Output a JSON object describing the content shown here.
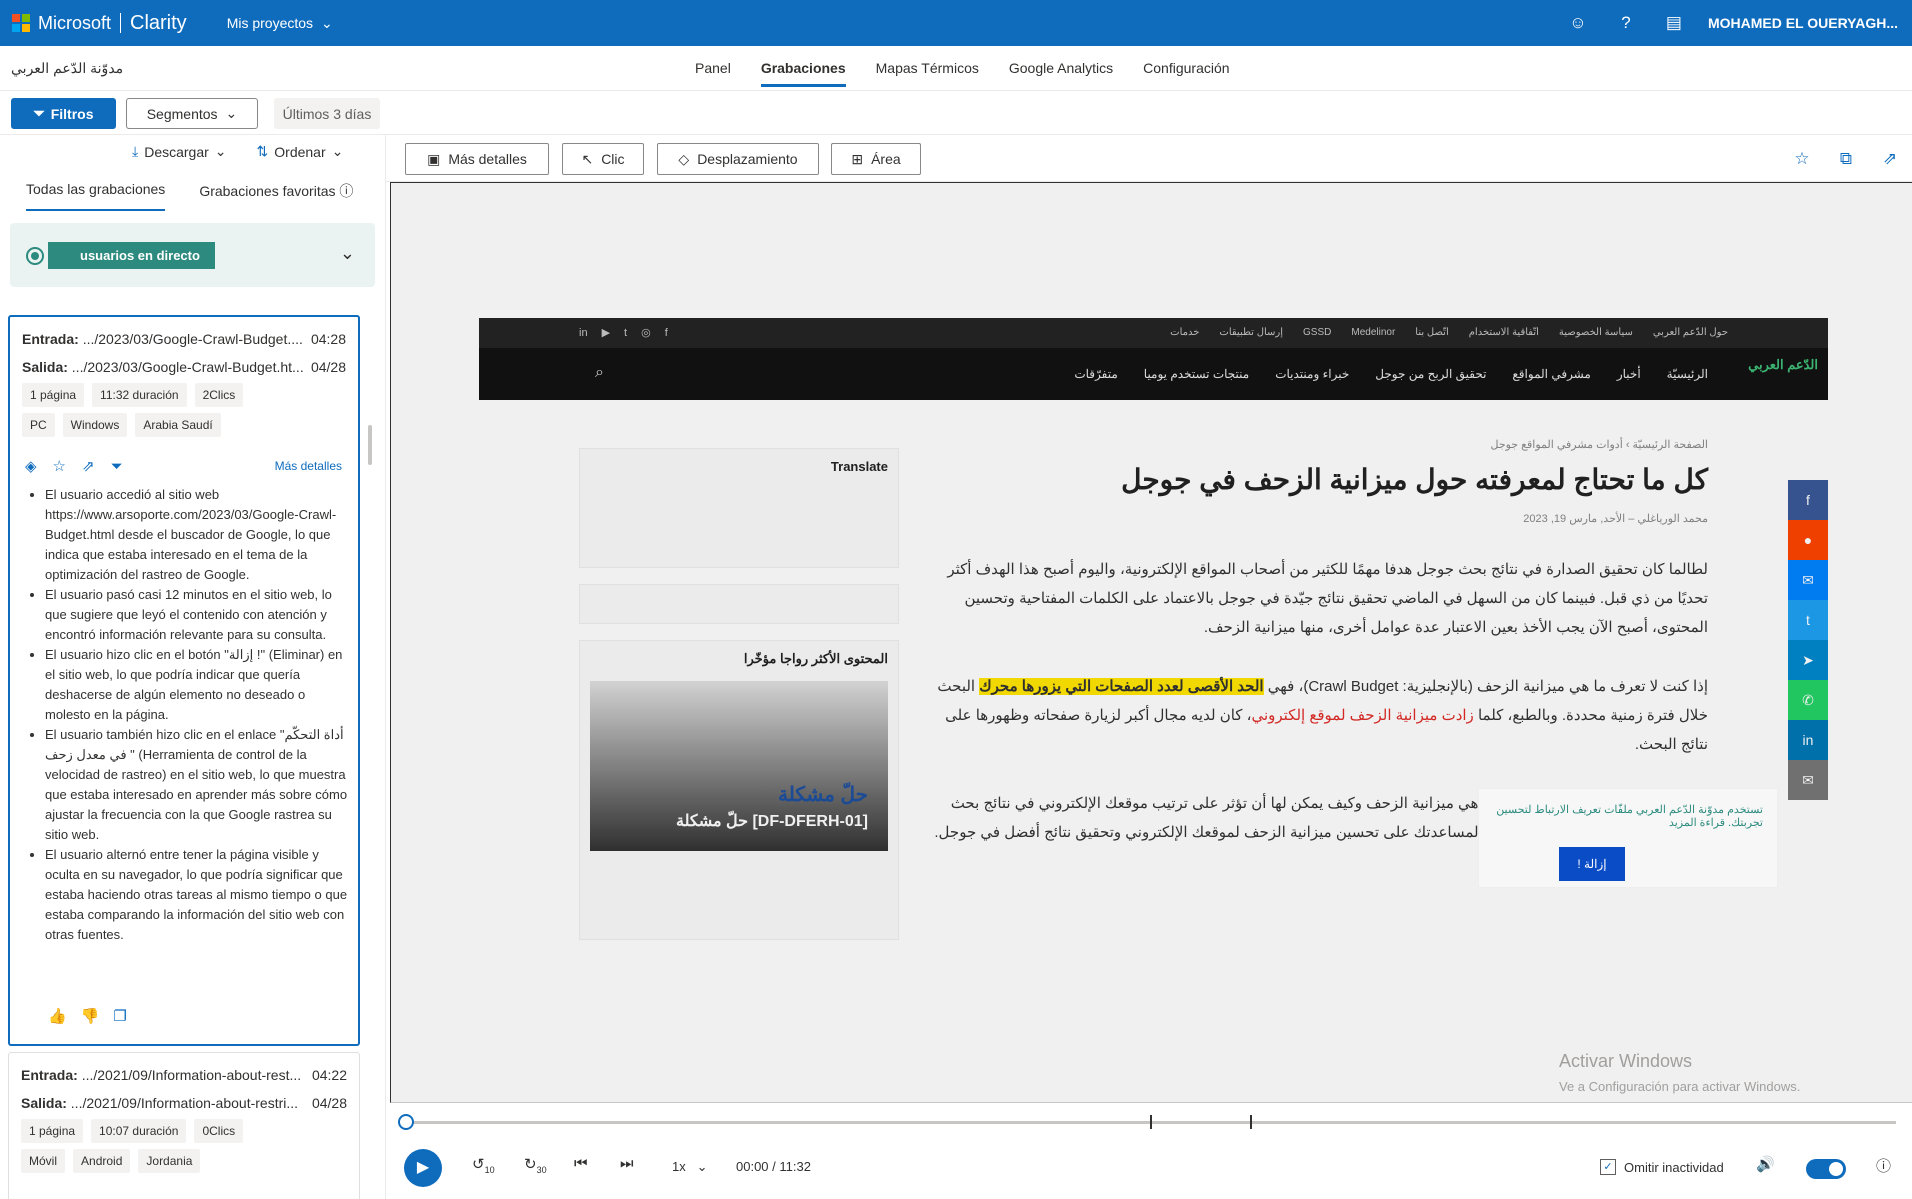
{
  "topbar": {
    "brand": "Microsoft",
    "product": "Clarity",
    "projects": "Mis proyectos",
    "user": "MOHAMED EL OUERYAGH...",
    "icons": [
      "smiley-icon",
      "help-icon",
      "document-icon"
    ]
  },
  "nav": {
    "site_name": "مدوّنة الدّعم العربي",
    "tabs": [
      "Panel",
      "Grabaciones",
      "Mapas Térmicos",
      "Google Analytics",
      "Configuración"
    ],
    "active_tab": "Grabaciones"
  },
  "filters": {
    "filters_label": "Filtros",
    "segments_label": "Segmentos",
    "date_range": "Últimos 3 días"
  },
  "left_panel": {
    "download": "Descargar",
    "sort": "Ordenar",
    "tab_all": "Todas las grabaciones",
    "tab_fav": "Grabaciones favoritas",
    "live_users": "usuarios en directo",
    "recordings": [
      {
        "entry_label": "Entrada:",
        "entry_url": ".../2023/03/Google-Crawl-Budget....",
        "entry_time": "04:28",
        "exit_label": "Salida:",
        "exit_url": ".../2023/03/Google-Crawl-Budget.ht...",
        "exit_date": "04/28",
        "tags1": [
          "1 página",
          "11:32 duración",
          "2Clics"
        ],
        "tags2": [
          "PC",
          "Windows",
          "Arabia Saudí"
        ],
        "more_details": "Más detalles",
        "summary": [
          "El usuario accedió al sitio web https://www.arsoporte.com/2023/03/Google-Crawl-Budget.html desde el buscador de Google, lo que indica que estaba interesado en el tema de la optimización del rastreo de Google.",
          "El usuario pasó casi 12 minutos en el sitio web, lo que sugiere que leyó el contenido con atención y encontró información relevante para su consulta.",
          "El usuario hizo clic en el botón \"إزالة !\" (Eliminar) en el sitio web, lo que podría indicar que quería deshacerse de algún elemento no deseado o molesto en la página.",
          "El usuario también hizo clic en el enlace \"أداة التحكّم في معدل زحف \" (Herramienta de control de la velocidad de rastreo) en el sitio web, lo que muestra que estaba interesado en aprender más sobre cómo ajustar la frecuencia con la que Google rastrea su sitio web.",
          "El usuario alternó entre tener la página visible y oculta en su navegador, lo que podría significar que estaba haciendo otras tareas al mismo tiempo o que estaba comparando la información del sitio web con otras fuentes."
        ]
      },
      {
        "entry_label": "Entrada:",
        "entry_url": ".../2021/09/Information-about-rest...",
        "entry_time": "04:22",
        "exit_label": "Salida:",
        "exit_url": ".../2021/09/Information-about-restri...",
        "exit_date": "04/28",
        "tags1": [
          "1 página",
          "10:07 duración",
          "0Clics"
        ],
        "tags2": [
          "Móvil",
          "Android",
          "Jordania"
        ]
      }
    ]
  },
  "toolbar": {
    "more_details": "Más detalles",
    "click": "Clic",
    "scroll": "Desplazamiento",
    "area": "Área"
  },
  "site": {
    "top_links": [
      "حول الدّعم العربي",
      "سياسة الخصوصية",
      "اتّفاقية الاستخدام",
      "اتّصل بنا",
      "Medelinor",
      "GSSD",
      "إرسال تطبيقات",
      "خدمات"
    ],
    "nav_items": [
      "الرئيسيّة",
      "أخبار",
      "مشرفي المواقع",
      "تحقيق الربح من جوجل",
      "خبراء ومنتديات",
      "منتجات تستخدم يوميا",
      "متفرّقات"
    ],
    "logo": "الدّعم العربي",
    "breadcrumb": "الصفحة الرئيسيّة › أدوات مشرفي المواقع جوجل",
    "title": "كل ما تحتاج لمعرفته حول ميزانية الزحف في جوجل",
    "meta": "محمد الورياغلي – الأحد, مارس 19, 2023",
    "para1": "لطالما كان تحقيق الصدارة في نتائج بحث جوجل هدفا مهمًا للكثير من أصحاب المواقع الإلكترونية، واليوم أصبح هذا الهدف أكثر تحديًا من ذي قبل. فبينما كان من السهل في الماضي تحقيق نتائج جيّدة في جوجل بالاعتماد على الكلمات المفتاحية وتحسين المحتوى، أصبح الآن يجب الأخذ بعين الاعتبار عدة عوامل أخرى، منها ميزانية الزحف.",
    "para2_a": "إذا كنت لا تعرف ما هي ميزانية الزحف (بالإنجليزية: Crawl Budget)، فهي ",
    "para2_hl": "الحد الأقصى لعدد الصفحات التي يزورها محرك",
    "para2_b": " البحث خلال فترة زمنية محددة. وبالطبع، كلما ",
    "para2_red": "زادت ميزانية الزحف لموقع إلكتروني",
    "para2_c": "، كان لديه مجال أكبر لزيارة صفحاته وظهورها على نتائج البحث.",
    "para3": "في هذا المقال، سنتعرّف بالتفصيل ما هي ميزانية الزحف وكيف يمكن لها أن تؤثر على ترتيب موقعك الإلكتروني في نتائج بحث جوجل، مع تقديم بعض النصائح القيمة لمساعدتك على تحسين ميزانية الزحف لموقعك الإلكتروني وتحقيق نتائج أفضل في جوجل.",
    "translate": "Translate",
    "popular": "المحتوى الأكثر رواجا مؤخّرا",
    "card_title": "حلّ مشكلة",
    "card_sub": "حلّ مشكلة [DF-DFERH-01]",
    "cookie_text": "تستخدم مدوّنة الدّعم العربي ملفّات تعريف الارتباط لتحسين تجربتك. قراءة المزيد",
    "cookie_btn": "إزالة !"
  },
  "watermark": {
    "title": "Activar Windows",
    "sub": "Ve a Configuración para activar Windows."
  },
  "player": {
    "progress": 0,
    "speed": "1x",
    "time": "00:00 / 11:32",
    "skip_inactive": "Omitir inactividad",
    "skip_back": "10",
    "skip_fwd": "30"
  }
}
